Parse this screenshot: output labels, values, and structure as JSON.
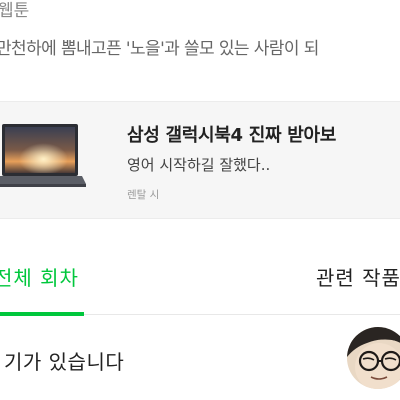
{
  "header": {
    "category": "웹툰",
    "subtitle": "만천하에 뽐내고픈 '노을'과 쓸모 있는 사람이 되"
  },
  "ad": {
    "title": "삼성 갤럭시북4 진짜 받아보",
    "description": "영어 시작하길 잘했다..",
    "label": "렌탈 시",
    "thumbnail_icon": "laptop-image"
  },
  "tabs": {
    "all_label": "전체 회차",
    "related_label": "관련 작품",
    "active_color": "#00c73c"
  },
  "comment": {
    "text": "기가 있습니다",
    "avatar_icon": "glasses-character-avatar"
  }
}
